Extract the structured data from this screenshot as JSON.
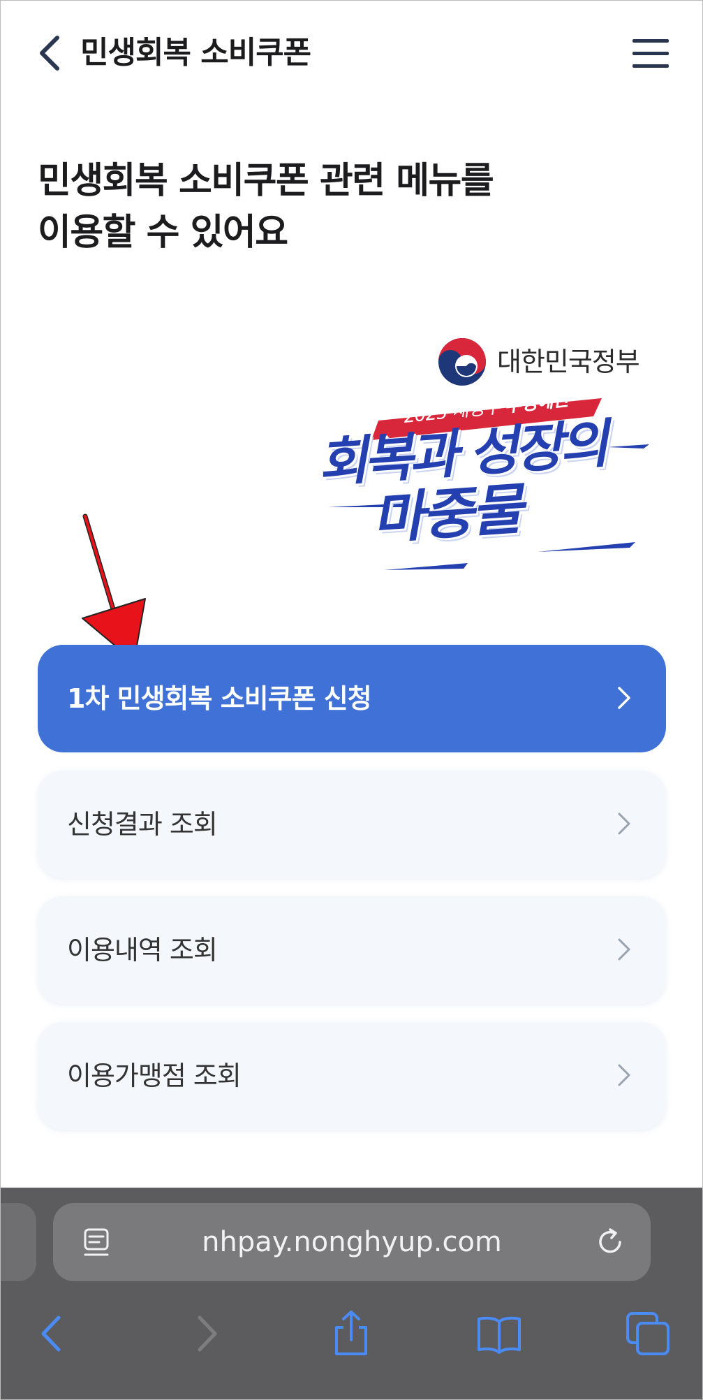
{
  "header": {
    "title": "민생회복 소비쿠폰"
  },
  "headline": {
    "line1": "민생회복 소비쿠폰 관련 메뉴를",
    "line2": "이용할 수 있어요"
  },
  "banner": {
    "gov_name": "대한민국정부",
    "budget_prefix": "2025 새정부 ",
    "budget_highlight": "추경예산",
    "slogan_line1": "회복과 성장의",
    "slogan_line2": "마중물",
    "colors": {
      "slogan": "#233fb0",
      "ribbon": "#d8263a"
    }
  },
  "menu": {
    "items": [
      {
        "label": "1차 민생회복 소비쿠폰 신청",
        "primary": true
      },
      {
        "label": "신청결과 조회",
        "primary": false
      },
      {
        "label": "이용내역 조회",
        "primary": false
      },
      {
        "label": "이용가맹점 조회",
        "primary": false
      }
    ]
  },
  "browser": {
    "url": "nhpay.nonghyup.com",
    "icons": [
      "reader-icon",
      "reload-icon",
      "back-icon",
      "forward-icon",
      "share-icon",
      "bookmarks-icon",
      "tabs-icon"
    ]
  },
  "colors": {
    "accent": "#3f71d6",
    "secondary_button_bg": "#f4f7fb",
    "browser_bar": "#5c5c5e",
    "toolbar_icon": "#4a8bf5",
    "annotation_arrow": "#e8121b"
  }
}
